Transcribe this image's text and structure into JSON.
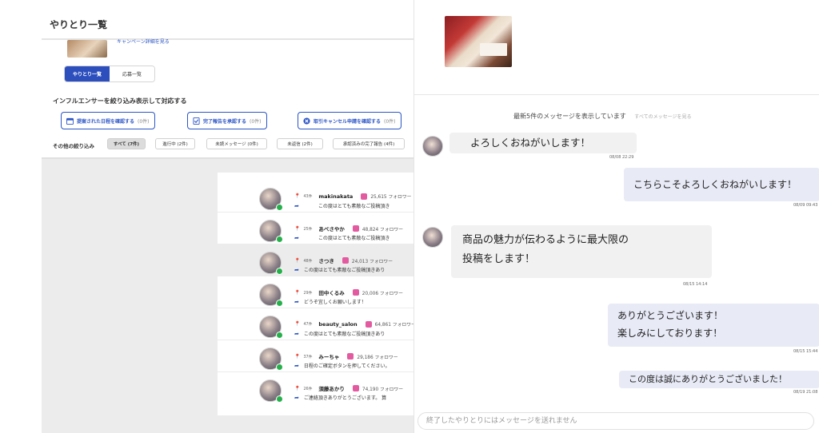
{
  "left": {
    "title": "やりとり一覧",
    "campaign_link": "キャンペーン詳細を見る",
    "tabs": [
      {
        "label": "やりとり一覧",
        "active": true
      },
      {
        "label": "応募一覧",
        "active": false
      }
    ],
    "section_title": "インフルエンサーを絞り込み表示して対応する",
    "actions": [
      {
        "label": "提案された日程を確認する",
        "count": "(0件)",
        "icon": "calendar-icon"
      },
      {
        "label": "完了報告を承認する",
        "count": "(0件)",
        "icon": "report-icon"
      },
      {
        "label": "取引キャンセル申請を確認する",
        "count": "(0件)",
        "icon": "cancel-icon"
      }
    ],
    "filter_label": "その他の絞り込み",
    "filters": [
      {
        "label": "すべて (7件)",
        "active": true
      },
      {
        "label": "進行中 (2件)",
        "active": false
      },
      {
        "label": "未読メッセージ (0件)",
        "active": false
      },
      {
        "label": "未返信 (2件)",
        "active": false
      },
      {
        "label": "承認済みの完了報告 (4件)",
        "active": false
      }
    ],
    "rows": [
      {
        "num": "43件",
        "name": "makinakata",
        "followers": "25,615 フォロワー",
        "message": "この度はとても素敵なご投稿頂き",
        "indent": true,
        "highlight": false
      },
      {
        "num": "25件",
        "name": "あべさやか",
        "followers": "48,824 フォロワー",
        "message": "この度はとても素敵なご投稿頂き",
        "indent": true,
        "highlight": false
      },
      {
        "num": "48件",
        "name": "さつき",
        "followers": "24,013 フォロワー",
        "message": "この度はとても素敵なご投稿頂きあり",
        "indent": false,
        "highlight": true
      },
      {
        "num": "29件",
        "name": "田中くるみ",
        "followers": "20,006 フォロワー",
        "message": "どうぞ宜しくお願いします！",
        "indent": false,
        "highlight": false
      },
      {
        "num": "47件",
        "name": "beauty_salon",
        "followers": "64,861 フォロワー",
        "message": "この度はとても素敵なご投稿頂きあり",
        "indent": false,
        "highlight": false
      },
      {
        "num": "37件",
        "name": "みーちゃ",
        "followers": "29,186 フォロワー",
        "message": "日程のご確定ボタンを押してください。",
        "indent": false,
        "highlight": false
      },
      {
        "num": "26件",
        "name": "須藤あかり",
        "followers": "74,190 フォロワー",
        "message": "ご連絡頂きありがとうございます。 算",
        "indent": false,
        "highlight": false
      }
    ]
  },
  "chat": {
    "notice": "最新5件のメッセージを表示しています",
    "notice_link": "すべてのメッセージを見る",
    "messages": [
      {
        "dir": "in",
        "lines": [
          "よろしくおねがいします！"
        ],
        "time": "08/08 22:29"
      },
      {
        "dir": "out",
        "lines": [
          "こちらこそよろしくおねがいします！"
        ],
        "time": "08/09 09:43"
      },
      {
        "dir": "in",
        "lines": [
          "商品の魅力が伝わるように最大限の",
          "投稿をします！"
        ],
        "time": "08/15 14:14"
      },
      {
        "dir": "out",
        "lines": [
          "ありがとうございます！",
          "楽しみにしております！"
        ],
        "time": "08/15 15:44"
      },
      {
        "dir": "out",
        "lines": [
          "この度は誠にありがとうございました！"
        ],
        "time": "08/19 21:08"
      }
    ],
    "input_placeholder": "終了したやりとりにはメッセージを送れません"
  }
}
